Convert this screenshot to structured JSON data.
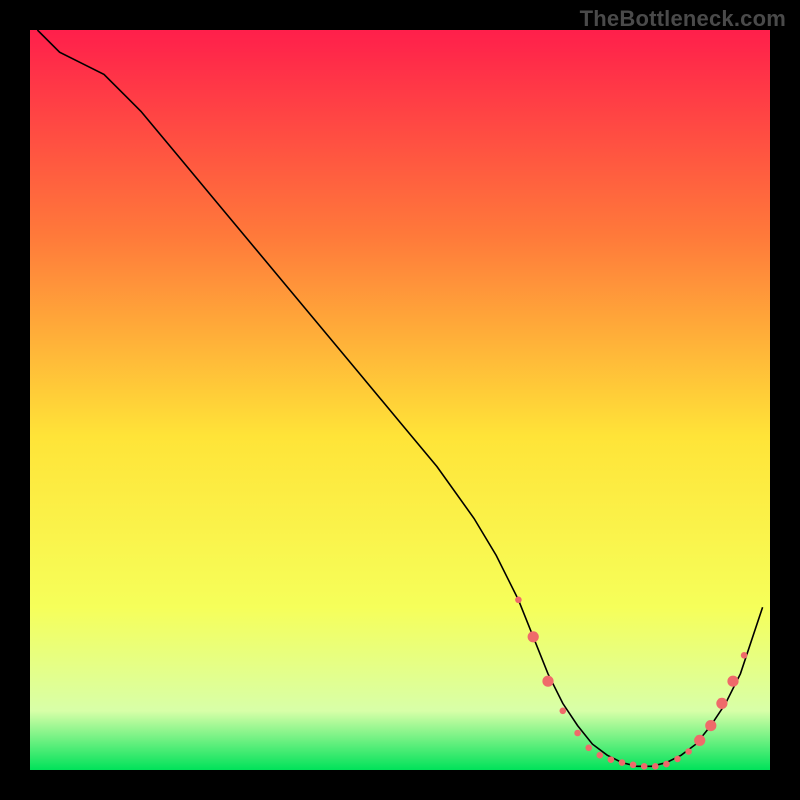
{
  "watermark": "TheBottleneck.com",
  "chart_data": {
    "type": "line",
    "title": "",
    "xlabel": "",
    "ylabel": "",
    "xlim": [
      0,
      100
    ],
    "ylim": [
      0,
      100
    ],
    "grid": false,
    "legend": false,
    "notes": "Background is a vertical rainbow gradient (red→yellow→green). The black curve appears to depict bottleneck percentage (y) vs some parameter (x); the minimum region (y≈0) is highlighted with pink marker dots.",
    "gradient_colors": {
      "top": "#ff1f4b",
      "mid_upper": "#ff7a3a",
      "mid": "#ffe438",
      "mid_lower": "#f6ff5a",
      "low": "#d8ffa8",
      "bottom": "#00e25a"
    },
    "series": [
      {
        "name": "curve",
        "x": [
          1,
          4,
          7,
          10,
          15,
          20,
          25,
          30,
          35,
          40,
          45,
          50,
          55,
          60,
          63,
          66,
          68,
          70,
          72,
          74,
          76,
          78,
          80,
          82,
          84,
          86,
          88,
          90,
          92,
          94,
          96,
          99
        ],
        "y": [
          100,
          97,
          95.5,
          94,
          89,
          83,
          77,
          71,
          65,
          59,
          53,
          47,
          41,
          34,
          29,
          23,
          18,
          13,
          9,
          6,
          3.5,
          2,
          1,
          0.5,
          0.5,
          1,
          2,
          3.5,
          6,
          9,
          13,
          22
        ],
        "stroke": "#000000",
        "stroke_width": 1.6
      }
    ],
    "markers": {
      "name": "highlight-dots",
      "fill": "#ef6a6a",
      "radius_small": 3.3,
      "radius_large": 5.6,
      "points": [
        {
          "x": 66,
          "y": 23,
          "r": "small"
        },
        {
          "x": 68,
          "y": 18,
          "r": "large"
        },
        {
          "x": 70,
          "y": 12,
          "r": "large"
        },
        {
          "x": 72,
          "y": 8,
          "r": "small"
        },
        {
          "x": 74,
          "y": 5,
          "r": "small"
        },
        {
          "x": 75.5,
          "y": 3,
          "r": "small"
        },
        {
          "x": 77,
          "y": 2,
          "r": "small"
        },
        {
          "x": 78.5,
          "y": 1.4,
          "r": "small"
        },
        {
          "x": 80,
          "y": 1,
          "r": "small"
        },
        {
          "x": 81.5,
          "y": 0.7,
          "r": "small"
        },
        {
          "x": 83,
          "y": 0.5,
          "r": "small"
        },
        {
          "x": 84.5,
          "y": 0.5,
          "r": "small"
        },
        {
          "x": 86,
          "y": 0.8,
          "r": "small"
        },
        {
          "x": 87.5,
          "y": 1.5,
          "r": "small"
        },
        {
          "x": 89,
          "y": 2.5,
          "r": "small"
        },
        {
          "x": 90.5,
          "y": 4,
          "r": "large"
        },
        {
          "x": 92,
          "y": 6,
          "r": "large"
        },
        {
          "x": 93.5,
          "y": 9,
          "r": "large"
        },
        {
          "x": 95,
          "y": 12,
          "r": "large"
        },
        {
          "x": 96.5,
          "y": 15.5,
          "r": "small"
        }
      ]
    }
  }
}
